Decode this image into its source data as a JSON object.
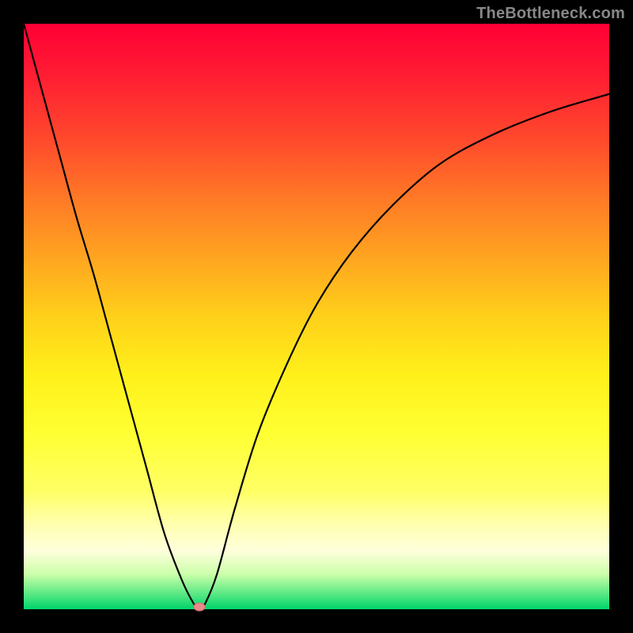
{
  "watermark": "TheBottleneck.com",
  "chart_data": {
    "type": "line",
    "title": "",
    "xlabel": "",
    "ylabel": "",
    "xlim": [
      0,
      1
    ],
    "ylim": [
      0,
      1
    ],
    "x": [
      0.0,
      0.03,
      0.06,
      0.09,
      0.12,
      0.15,
      0.18,
      0.21,
      0.24,
      0.27,
      0.29,
      0.3,
      0.31,
      0.33,
      0.36,
      0.4,
      0.45,
      0.5,
      0.56,
      0.63,
      0.71,
      0.8,
      0.9,
      1.0
    ],
    "values": [
      1.0,
      0.89,
      0.78,
      0.67,
      0.57,
      0.46,
      0.35,
      0.24,
      0.13,
      0.05,
      0.01,
      0.0,
      0.01,
      0.06,
      0.17,
      0.3,
      0.42,
      0.52,
      0.61,
      0.69,
      0.76,
      0.81,
      0.85,
      0.88
    ],
    "minimum_x": 0.3,
    "minimum_y": 0.0,
    "background_gradient": {
      "top": "#ff0035",
      "mid": "#ffd01a",
      "bottom": "#00d46a"
    },
    "frame_color": "#000000",
    "curve_color": "#000000",
    "minimum_marker_color": "#e88a8a"
  }
}
